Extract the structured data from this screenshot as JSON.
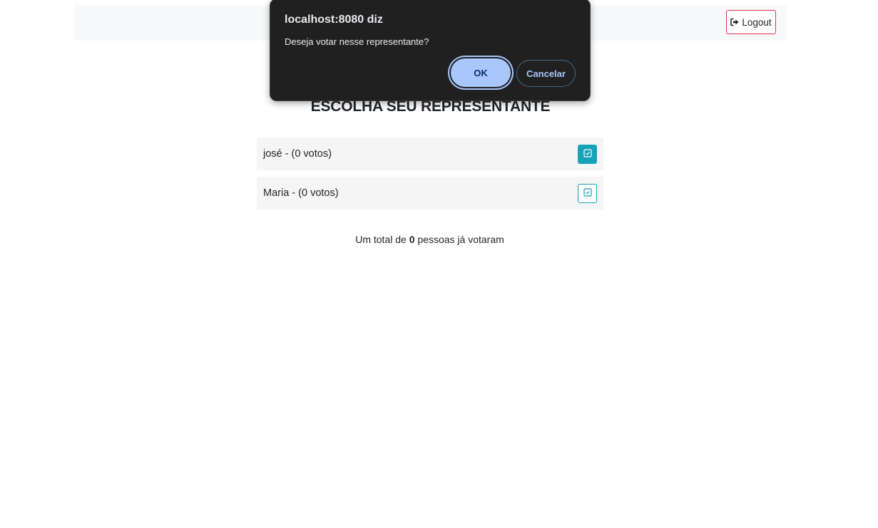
{
  "navbar": {
    "logout_label": "Logout"
  },
  "main": {
    "title": "ESCOLHA SEU REPRESENTANTE",
    "candidates": [
      {
        "label": "josé - (0 votos)"
      },
      {
        "label": "Maria - (0 votos)"
      }
    ],
    "total_prefix": "Um total de ",
    "total_count": "0",
    "total_suffix": " pessoas já votaram"
  },
  "dialog": {
    "title": "localhost:8080 diz",
    "message": "Deseja votar nesse representante?",
    "ok_label": "OK",
    "cancel_label": "Cancelar"
  },
  "colors": {
    "accent": "#17a2b8",
    "danger": "#dc3545",
    "dialog_bg": "#202020",
    "dialog_button": "#a8c7fa"
  },
  "icons": {
    "logout": "sign-out-icon",
    "vote": "check-square-icon"
  }
}
